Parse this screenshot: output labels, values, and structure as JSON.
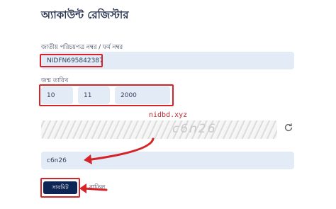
{
  "page": {
    "title": "অ্যাকাউন্ট রেজিস্টার"
  },
  "form": {
    "nid_label": "জাতীয় পরিচয়পত্র নম্বর / ফর্ম নম্বর",
    "nid_value": "NIDFN695842387",
    "dob_label": "জন্ম তারিখ",
    "dob_day": "10",
    "dob_month": "11",
    "dob_year": "2000",
    "captcha_image_text": "c6n26",
    "captcha_value": "c6n26",
    "submit_label": "সাবমিট",
    "cancel_label": "বাতিল"
  },
  "watermark": "nidbd.xyz",
  "colors": {
    "input_bg": "#e3ecf6",
    "button_bg": "#0d2554",
    "annotation_red": "#d4242a"
  }
}
